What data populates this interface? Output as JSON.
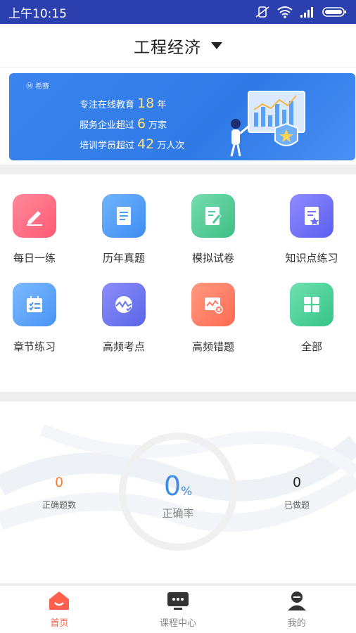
{
  "status_bar": {
    "time": "上午10:15"
  },
  "header": {
    "title": "工程经济"
  },
  "banner": {
    "logo": "Ⓜ 希赛",
    "line1_prefix": "专注在线教育",
    "line1_num": "18",
    "line1_suffix": "年",
    "line2_prefix": "服务企业超过",
    "line2_num": "6",
    "line2_suffix": "万家",
    "line3_prefix": "培训学员超过",
    "line3_num": "42",
    "line3_suffix": "万人次"
  },
  "grid": {
    "items": [
      {
        "label": "每日一练",
        "icon": "pencil-icon",
        "color": "#ff6b7f"
      },
      {
        "label": "历年真题",
        "icon": "document-icon",
        "color": "#4e9df5"
      },
      {
        "label": "模拟试卷",
        "icon": "exam-paper-icon",
        "color": "#52c99a"
      },
      {
        "label": "知识点练习",
        "icon": "star-doc-icon",
        "color": "#6b6ff5"
      },
      {
        "label": "章节练习",
        "icon": "calendar-list-icon",
        "color": "#5aa6f7"
      },
      {
        "label": "高频考点",
        "icon": "wave-icon",
        "color": "#6b76f0"
      },
      {
        "label": "高频错题",
        "icon": "error-chart-icon",
        "color": "#ff7a62"
      },
      {
        "label": "全部",
        "icon": "grid-icon",
        "color": "#4fd39b"
      }
    ]
  },
  "stats": {
    "correct_count": "0",
    "correct_count_label": "正确题数",
    "accuracy": "0",
    "accuracy_unit": "%",
    "accuracy_label": "正确率",
    "done": "0",
    "done_label": "已做题"
  },
  "tabbar": {
    "home": "首页",
    "courses": "课程中心",
    "mine": "我的",
    "active_color": "#ff5f4b"
  }
}
